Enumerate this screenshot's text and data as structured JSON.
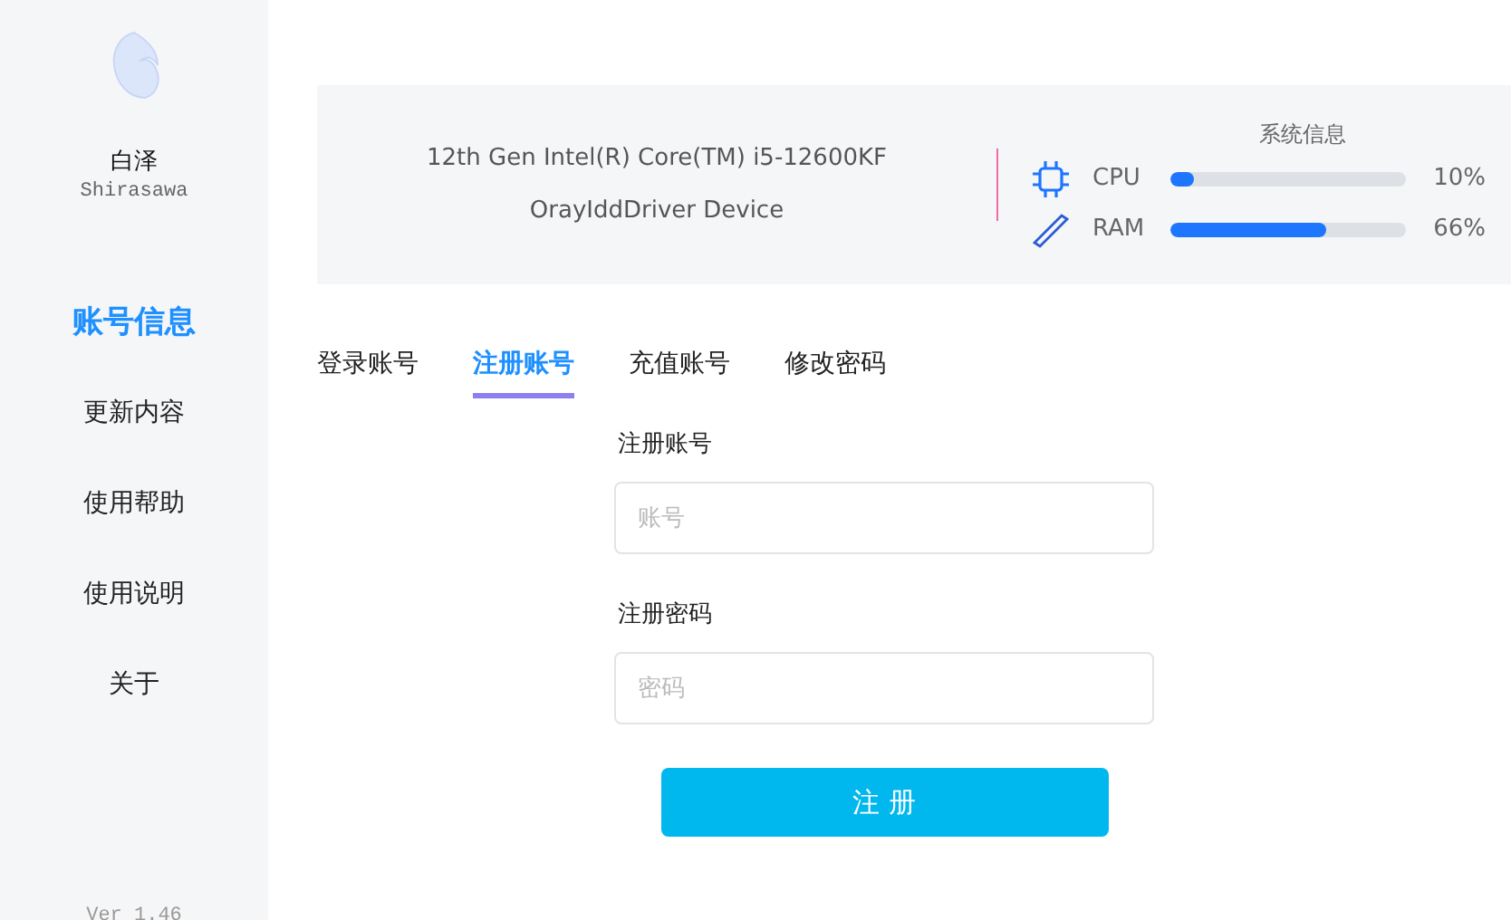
{
  "app": {
    "name": "白泽",
    "subtitle": "Shirasawa",
    "version": "Ver 1.46"
  },
  "sidebar": {
    "items": [
      {
        "label": "账号信息",
        "selected": true
      },
      {
        "label": "更新内容",
        "selected": false
      },
      {
        "label": "使用帮助",
        "selected": false
      },
      {
        "label": "使用说明",
        "selected": false
      },
      {
        "label": "关于",
        "selected": false
      }
    ]
  },
  "hardware": {
    "cpu_name": "12th Gen Intel(R) Core(TM) i5-12600KF",
    "gpu_name": "OrayIddDriver Device"
  },
  "system_info": {
    "title": "系统信息",
    "meters": [
      {
        "kind": "cpu",
        "label": "CPU",
        "level": 0.1,
        "reading": "10%"
      },
      {
        "kind": "ram",
        "label": "RAM",
        "level": 0.66,
        "reading": "66%"
      }
    ]
  },
  "tabs": [
    {
      "label": "登录账号",
      "selected": false
    },
    {
      "label": "注册账号",
      "selected": true
    },
    {
      "label": "充值账号",
      "selected": false
    },
    {
      "label": "修改密码",
      "selected": false
    }
  ],
  "form": {
    "fields": [
      {
        "label": "注册账号",
        "placeholder": "账号"
      },
      {
        "label": "注册密码",
        "placeholder": "密码"
      }
    ],
    "submit": "注 册"
  }
}
